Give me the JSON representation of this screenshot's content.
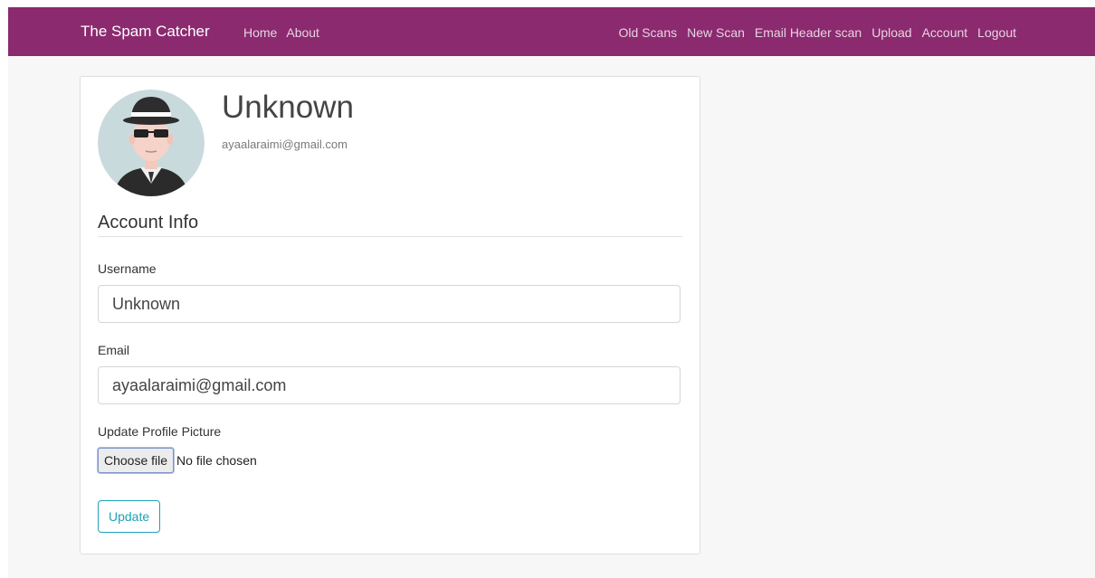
{
  "nav": {
    "brand": "The Spam Catcher",
    "left_links": [
      "Home",
      "About"
    ],
    "right_links": [
      "Old Scans",
      "New Scan",
      "Email Header scan",
      "Upload",
      "Account",
      "Logout"
    ]
  },
  "profile": {
    "name": "Unknown",
    "email": "ayaalaraimi@gmail.com",
    "avatar_icon": "spy-avatar-icon"
  },
  "account_info": {
    "title": "Account Info",
    "username_label": "Username",
    "username_value": "Unknown",
    "email_label": "Email",
    "email_value": "ayaalaraimi@gmail.com",
    "picture_label": "Update Profile Picture",
    "choose_file_label": "Choose file",
    "file_status": "No file chosen",
    "update_label": "Update"
  },
  "colors": {
    "navbar": "#8b2a6f",
    "update_button": "#1fa2b5"
  }
}
